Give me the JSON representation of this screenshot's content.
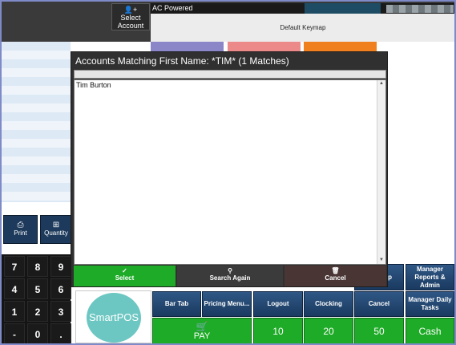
{
  "top": {
    "select_account_label": "Select Account",
    "status_label": "AC Powered",
    "keymap_label": "Default Keymap",
    "tile_colors": [
      "#8a86c8",
      "#ec8a8a",
      "#f0801e"
    ]
  },
  "left": {
    "print_label": "Print",
    "quantity_label": "Quantity"
  },
  "keypad": {
    "keys": [
      "7",
      "8",
      "9",
      "4",
      "5",
      "6",
      "1",
      "2",
      "3",
      "-",
      "0",
      "."
    ]
  },
  "logo": {
    "text": "SmartPOS"
  },
  "bottom_row": {
    "bar_tab": "Bar Tab",
    "pricing_menu": "Pricing Menu...",
    "logout": "Logout",
    "clocking": "Clocking",
    "cancel": "Cancel",
    "manager_daily_tasks": "Manager Daily Tasks"
  },
  "right_row": {
    "partial_label": "p",
    "manager_reports": "Manager Reports & Admin"
  },
  "pay_row": {
    "pay_label": "PAY",
    "amounts": [
      "10",
      "20",
      "50"
    ],
    "cash_label": "Cash"
  },
  "dialog": {
    "title": "Accounts Matching First Name: *TIM* (1 Matches)",
    "items": [
      "Tim Burton"
    ],
    "select_label": "Select",
    "search_again_label": "Search Again",
    "cancel_label": "Cancel"
  },
  "colors": {
    "green": "#1eab27",
    "navy": "#1d3a5c",
    "logo_teal": "#6cc7c2"
  }
}
